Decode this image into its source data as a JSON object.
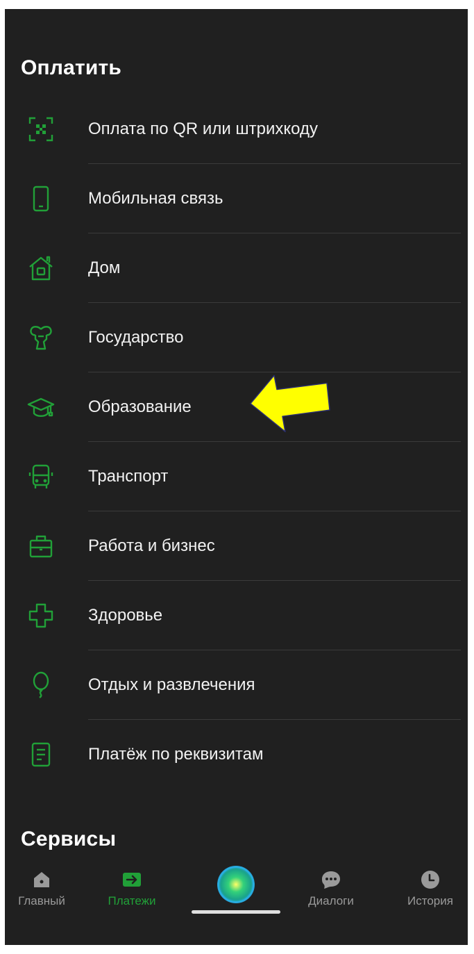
{
  "colors": {
    "background": "#202020",
    "accent": "#21a038",
    "text": "#f2f2f2",
    "divider": "#3b3b3b",
    "tab_inactive": "#9a9a9a",
    "annotation_arrow": "#ffff00"
  },
  "pay_section": {
    "title": "Оплатить",
    "items": [
      {
        "label": "Оплата по QR или штрихкоду",
        "icon": "qr-scan-icon"
      },
      {
        "label": "Мобильная связь",
        "icon": "mobile-phone-icon"
      },
      {
        "label": "Дом",
        "icon": "house-icon"
      },
      {
        "label": "Государство",
        "icon": "state-emblem-icon"
      },
      {
        "label": "Образование",
        "icon": "graduation-cap-icon"
      },
      {
        "label": "Транспорт",
        "icon": "bus-icon"
      },
      {
        "label": "Работа и бизнес",
        "icon": "briefcase-icon"
      },
      {
        "label": "Здоровье",
        "icon": "medical-cross-icon"
      },
      {
        "label": "Отдых и развлечения",
        "icon": "balloon-icon"
      },
      {
        "label": "Платёж по реквизитам",
        "icon": "document-icon"
      }
    ]
  },
  "services_section": {
    "title": "Сервисы"
  },
  "tabbar": {
    "tabs": [
      {
        "label": "Главный",
        "icon": "home-icon",
        "active": false
      },
      {
        "label": "Платежи",
        "icon": "payments-arrow-icon",
        "active": true
      },
      {
        "label": "",
        "icon": "assistant-orb-icon",
        "active": false
      },
      {
        "label": "Диалоги",
        "icon": "chat-bubble-icon",
        "active": false
      },
      {
        "label": "История",
        "icon": "clock-icon",
        "active": false
      }
    ]
  }
}
